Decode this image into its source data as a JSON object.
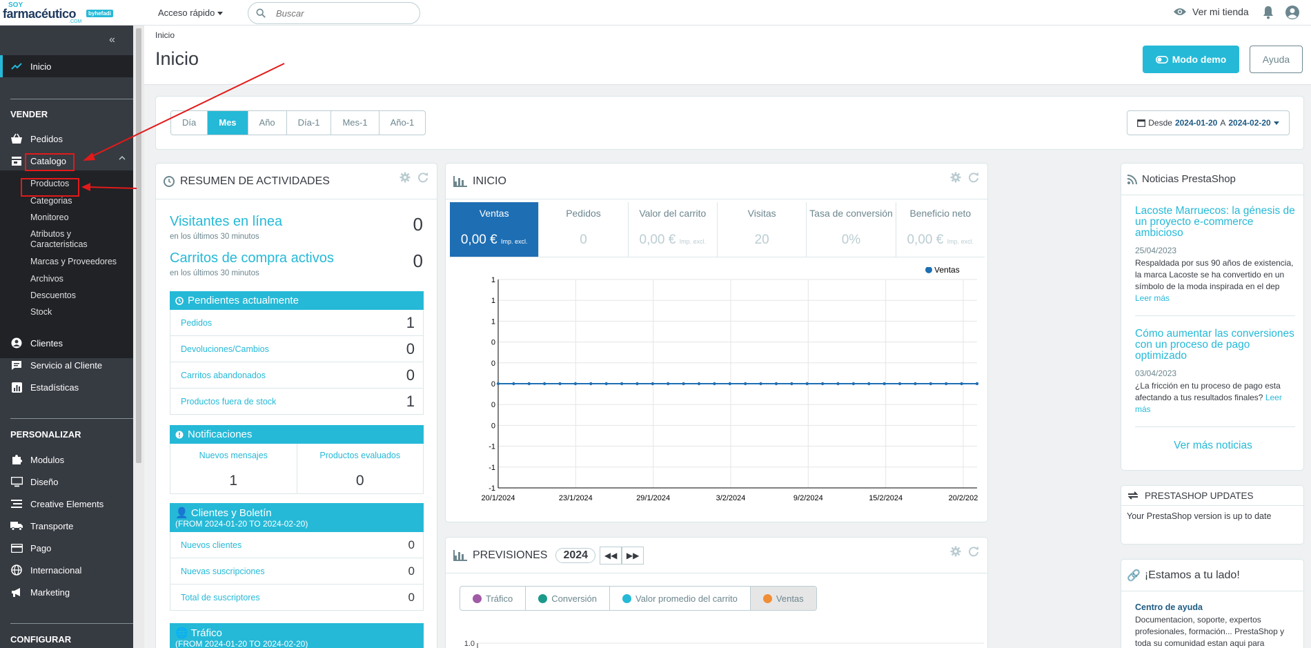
{
  "header": {
    "logo": {
      "soy": "SOY",
      "brand": "farmacéutico",
      "com": ".COM",
      "badge": "byhefadi"
    },
    "quick_access": "Acceso rápido",
    "search_placeholder": "Buscar",
    "view_store": "Ver mi tienda"
  },
  "sidebar": {
    "home": "Inicio",
    "section_sell": "VENDER",
    "orders": "Pedidos",
    "catalog": "Catalogo",
    "catalog_sub": [
      "Productos",
      "Categorias",
      "Monitoreo",
      "Atributos y Caracteristicas",
      "Marcas y Proveedores",
      "Archivos",
      "Descuentos",
      "Stock"
    ],
    "customers": "Clientes",
    "service": "Servicio al Cliente",
    "stats": "Estadísticas",
    "section_personalize": "PERSONALIZAR",
    "modules": "Modulos",
    "design": "Diseño",
    "creative": "Creative Elements",
    "shipping": "Transporte",
    "payment": "Pago",
    "international": "Internacional",
    "marketing": "Marketing",
    "section_configure": "CONFIGURAR"
  },
  "page": {
    "breadcrumb": "Inicio",
    "title": "Inicio",
    "demo_button": "Modo demo",
    "help_button": "Ayuda"
  },
  "period": {
    "tabs": [
      "Día",
      "Mes",
      "Año",
      "Día-1",
      "Mes-1",
      "Año-1"
    ],
    "active": "Mes",
    "range_from_label": "Desde",
    "range_from": "2024-01-20",
    "range_to_label": "A",
    "range_to": "2024-02-20"
  },
  "activity": {
    "title": "RESUMEN DE ACTIVIDADES",
    "visitors_label": "Visitantes en línea",
    "visitors_sub": "en los últimos 30 minutos",
    "visitors_value": "0",
    "carts_label": "Carritos de compra activos",
    "carts_sub": "en los últimos 30 minutos",
    "carts_value": "0",
    "pending_title": "Pendientes actualmente",
    "pending": [
      {
        "label": "Pedidos",
        "value": "1"
      },
      {
        "label": "Devoluciones/Cambios",
        "value": "0"
      },
      {
        "label": "Carritos abandonados",
        "value": "0"
      },
      {
        "label": "Productos fuera de stock",
        "value": "1"
      }
    ],
    "notif_title": "Notificaciones",
    "notif_messages_label": "Nuevos mensajes",
    "notif_messages_value": "1",
    "notif_reviews_label": "Productos evaluados",
    "notif_reviews_value": "0",
    "clients_title": "Clientes y Boletín",
    "clients_range": "(FROM 2024-01-20 TO 2024-02-20)",
    "clients": [
      {
        "label": "Nuevos clientes",
        "value": "0"
      },
      {
        "label": "Nuevas suscripciones",
        "value": "0"
      },
      {
        "label": "Total de suscriptores",
        "value": "0"
      }
    ],
    "traffic_title": "Tráfico",
    "traffic_range": "(FROM 2024-01-20 TO 2024-02-20)"
  },
  "dashboard": {
    "title": "INICIO",
    "kpis": [
      {
        "label": "Ventas",
        "value": "0,00 €",
        "suffix": "Imp. excl."
      },
      {
        "label": "Pedidos",
        "value": "0",
        "suffix": ""
      },
      {
        "label": "Valor del carrito",
        "value": "0,00 €",
        "suffix": "Imp. excl."
      },
      {
        "label": "Visitas",
        "value": "20",
        "suffix": ""
      },
      {
        "label": "Tasa de conversión",
        "value": "0%",
        "suffix": ""
      },
      {
        "label": "Beneficio neto",
        "value": "0,00 €",
        "suffix": "Imp. excl."
      }
    ]
  },
  "chart_data": {
    "type": "line",
    "title": "",
    "xlabel": "",
    "ylabel": "",
    "y_tick_labels": [
      "1",
      "1",
      "1",
      "0",
      "0",
      "0",
      "0",
      "0",
      "-1",
      "-1",
      "-1"
    ],
    "x_tick_labels": [
      "20/1/2024",
      "23/1/2024",
      "29/1/2024",
      "3/2/2024",
      "9/2/2024",
      "15/2/2024",
      "20/2/202"
    ],
    "legend_position": "top-right",
    "grid": true,
    "series": [
      {
        "name": "Ventas",
        "color": "#1e6eb3",
        "values": [
          0,
          0,
          0,
          0,
          0,
          0,
          0,
          0,
          0,
          0,
          0,
          0,
          0,
          0,
          0,
          0,
          0,
          0,
          0,
          0,
          0,
          0,
          0,
          0,
          0,
          0,
          0,
          0,
          0,
          0,
          0,
          0
        ]
      }
    ]
  },
  "forecast": {
    "title": "PREVISIONES",
    "year": "2024",
    "legend": [
      {
        "label": "Tráfico",
        "color": "#a05ba6"
      },
      {
        "label": "Conversión",
        "color": "#1b9a8b"
      },
      {
        "label": "Valor promedio del carrito",
        "color": "#25b9d7"
      },
      {
        "label": "Ventas",
        "color": "#f08e35"
      }
    ],
    "axis_top_label": "1.0"
  },
  "news": {
    "title": "Noticias PrestaShop",
    "items": [
      {
        "title": "Lacoste Marruecos: la génesis de un proyecto e-commerce ambicioso",
        "date": "25/04/2023",
        "body": "Respaldada por sus 90 años de existencia, la marca Lacoste se ha convertido en un símbolo de la moda inspirada en el dep",
        "more": "Leer más"
      },
      {
        "title": "Cómo aumentar las conversiones con un proceso de pago optimizado",
        "date": "03/04/2023",
        "body": "¿La fricción en tu proceso de pago esta afectando a tus resultados finales?",
        "more": "Leer más"
      }
    ],
    "see_more": "Ver más noticias"
  },
  "updates": {
    "title": "PRESTASHOP UPDATES",
    "body": "Your PrestaShop version is up to date"
  },
  "support": {
    "title": "¡Estamos a tu lado!",
    "link": "Centro de ayuda",
    "body": "Documentacion, soporte, expertos profesionales, formación... PrestaShop y toda su comunidad estan aqui para"
  },
  "colors": {
    "accent": "#25b9d7",
    "sidebar": "#363a41",
    "annotation": "#e21a1a",
    "kpi_selected": "#1e6eb3"
  }
}
